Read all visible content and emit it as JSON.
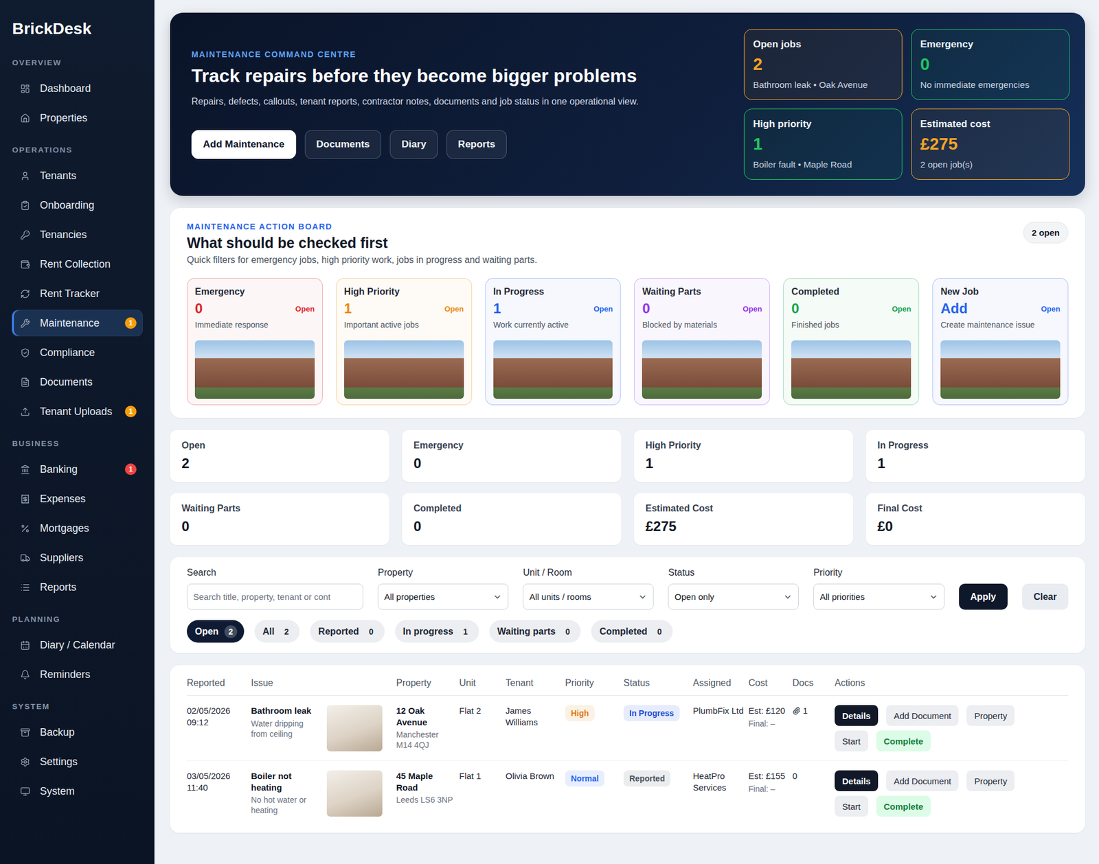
{
  "sidebar": {
    "logo": "BrickDesk",
    "sections": [
      {
        "title": "OVERVIEW",
        "items": [
          {
            "label": "Dashboard",
            "selected": false
          },
          {
            "label": "Properties",
            "selected": false
          }
        ]
      },
      {
        "title": "OPERATIONS",
        "items": [
          {
            "label": "Tenants",
            "selected": false
          },
          {
            "label": "Onboarding",
            "selected": false
          },
          {
            "label": "Tenancies",
            "selected": false
          },
          {
            "label": "Rent Collection",
            "selected": false
          },
          {
            "label": "Rent Tracker",
            "selected": false
          },
          {
            "label": "Maintenance",
            "selected": true,
            "badge": "1",
            "color": "#f59e0b"
          },
          {
            "label": "Compliance",
            "selected": false
          },
          {
            "label": "Documents",
            "selected": false
          },
          {
            "label": "Tenant Uploads",
            "selected": false,
            "badge": "1",
            "color": "#f59e0b"
          }
        ]
      },
      {
        "title": "BUSINESS",
        "items": [
          {
            "label": "Banking",
            "selected": false,
            "badge": "1",
            "color": "#ef4444"
          },
          {
            "label": "Expenses",
            "selected": false
          },
          {
            "label": "Mortgages",
            "selected": false
          },
          {
            "label": "Suppliers",
            "selected": false
          },
          {
            "label": "Reports",
            "selected": false
          }
        ]
      },
      {
        "title": "PLANNING",
        "items": [
          {
            "label": "Diary / Calendar",
            "selected": false
          },
          {
            "label": "Reminders",
            "selected": false
          }
        ]
      },
      {
        "title": "SYSTEM",
        "items": [
          {
            "label": "Backup",
            "selected": false
          },
          {
            "label": "Settings",
            "selected": false
          },
          {
            "label": "System",
            "selected": false
          }
        ]
      }
    ]
  },
  "hero": {
    "eyebrow": "MAINTENANCE COMMAND CENTRE",
    "title": "Track repairs before they become bigger problems",
    "subtitle": "Repairs, defects, callouts, tenant reports, contractor notes, documents and job status in one operational view.",
    "buttons": [
      {
        "label": "Add Maintenance",
        "kind": "primary"
      },
      {
        "label": "Documents",
        "kind": "secondary"
      },
      {
        "label": "Diary",
        "kind": "secondary"
      },
      {
        "label": "Reports",
        "kind": "secondary"
      }
    ],
    "stats": [
      {
        "label": "Open jobs",
        "value": "2",
        "note": "Bathroom leak • Oak Avenue",
        "color": "#f5a524"
      },
      {
        "label": "Emergency",
        "value": "0",
        "note": "No immediate emergencies",
        "color": "#22c55e"
      },
      {
        "label": "High priority",
        "value": "1",
        "note": "Boiler fault • Maple Road",
        "color": "#22c55e"
      },
      {
        "label": "Estimated cost",
        "value": "£275",
        "note": "2 open job(s)",
        "color": "#f5a524"
      }
    ]
  },
  "board": {
    "eyebrow": "MAINTENANCE ACTION BOARD",
    "title": "What should be checked first",
    "subtitle": "Quick filters for emergency jobs, high priority work, jobs in progress and waiting parts.",
    "badge": "2 open",
    "cards": [
      {
        "title": "Emergency",
        "value": "0",
        "tag": "Open",
        "note": "Immediate response",
        "color": "#dc2626"
      },
      {
        "title": "High Priority",
        "value": "1",
        "tag": "Open",
        "note": "Important active jobs",
        "color": "#ea8a0c"
      },
      {
        "title": "In Progress",
        "value": "1",
        "tag": "Open",
        "note": "Work currently active",
        "color": "#2563eb"
      },
      {
        "title": "Waiting Parts",
        "value": "0",
        "tag": "Open",
        "note": "Blocked by materials",
        "color": "#9333ea"
      },
      {
        "title": "Completed",
        "value": "0",
        "tag": "Open",
        "note": "Finished jobs",
        "color": "#16a34a"
      },
      {
        "title": "New Job",
        "value": "Add",
        "tag": "Open",
        "note": "Create maintenance issue",
        "color": "#2563eb"
      }
    ]
  },
  "summary": [
    {
      "label": "Open",
      "value": "2"
    },
    {
      "label": "Emergency",
      "value": "0"
    },
    {
      "label": "High Priority",
      "value": "1"
    },
    {
      "label": "In Progress",
      "value": "1"
    },
    {
      "label": "Waiting Parts",
      "value": "0"
    },
    {
      "label": "Completed",
      "value": "0"
    },
    {
      "label": "Estimated Cost",
      "value": "£275"
    },
    {
      "label": "Final Cost",
      "value": "£0"
    }
  ],
  "filters": {
    "fields": [
      {
        "label": "Search",
        "kind": "input",
        "value": "Search title, property, tenant or cont"
      },
      {
        "label": "Property",
        "kind": "select",
        "value": "All properties"
      },
      {
        "label": "Unit / Room",
        "kind": "select",
        "value": "All units / rooms"
      },
      {
        "label": "Status",
        "kind": "select",
        "value": "Open only"
      },
      {
        "label": "Priority",
        "kind": "select",
        "value": "All priorities"
      }
    ],
    "buttons": [
      {
        "label": "Apply",
        "kind": "primary"
      },
      {
        "label": "Clear",
        "kind": "secondary"
      }
    ],
    "chips": [
      {
        "label": "Open",
        "count": "2",
        "selected": true
      },
      {
        "label": "All",
        "count": "2",
        "selected": false
      },
      {
        "label": "Reported",
        "count": "0",
        "selected": false
      },
      {
        "label": "In progress",
        "count": "1",
        "selected": false
      },
      {
        "label": "Waiting parts",
        "count": "0",
        "selected": false
      },
      {
        "label": "Completed",
        "count": "0",
        "selected": false
      }
    ]
  },
  "table": {
    "columns": [
      "Reported",
      "Issue",
      "Property",
      "Unit",
      "Tenant",
      "Priority",
      "Status",
      "Assigned",
      "Cost",
      "Docs",
      "Actions"
    ],
    "rows": [
      {
        "date": "02/05/2026",
        "time": "09:12",
        "title": "Bathroom leak",
        "description": "Water dripping from ceiling",
        "property": "12 Oak Avenue",
        "address": "Manchester M14 4QJ",
        "unit": "Flat 2",
        "tenant": "James Williams",
        "priority": {
          "label": "High",
          "color": "#e07b12"
        },
        "status": {
          "label": "In Progress",
          "color": "#1d4ed8"
        },
        "assigned": "PlumbFix Ltd",
        "estimate": "Est: £120",
        "final": "Final: –",
        "docs": "1",
        "attachment": true,
        "actions": [
          {
            "label": "Details",
            "kind": "primary"
          },
          {
            "label": "Add Document",
            "kind": "secondary"
          },
          {
            "label": "Property",
            "kind": "secondary"
          },
          {
            "label": "Start",
            "kind": "secondary"
          },
          {
            "label": "Complete",
            "kind": "success"
          }
        ]
      },
      {
        "date": "03/05/2026",
        "time": "11:40",
        "title": "Boiler not heating",
        "description": "No hot water or heating",
        "property": "45 Maple Road",
        "address": "Leeds LS6 3NP",
        "unit": "Flat 1",
        "tenant": "Olivia Brown",
        "priority": {
          "label": "Normal",
          "color": "#2563eb"
        },
        "status": {
          "label": "Reported",
          "color": "#4b5563"
        },
        "assigned": "HeatPro Services",
        "estimate": "Est: £155",
        "final": "Final: –",
        "docs": "0",
        "attachment": false,
        "actions": [
          {
            "label": "Details",
            "kind": "primary"
          },
          {
            "label": "Add Document",
            "kind": "secondary"
          },
          {
            "label": "Property",
            "kind": "secondary"
          },
          {
            "label": "Start",
            "kind": "secondary"
          },
          {
            "label": "Complete",
            "kind": "success"
          }
        ]
      }
    ]
  }
}
